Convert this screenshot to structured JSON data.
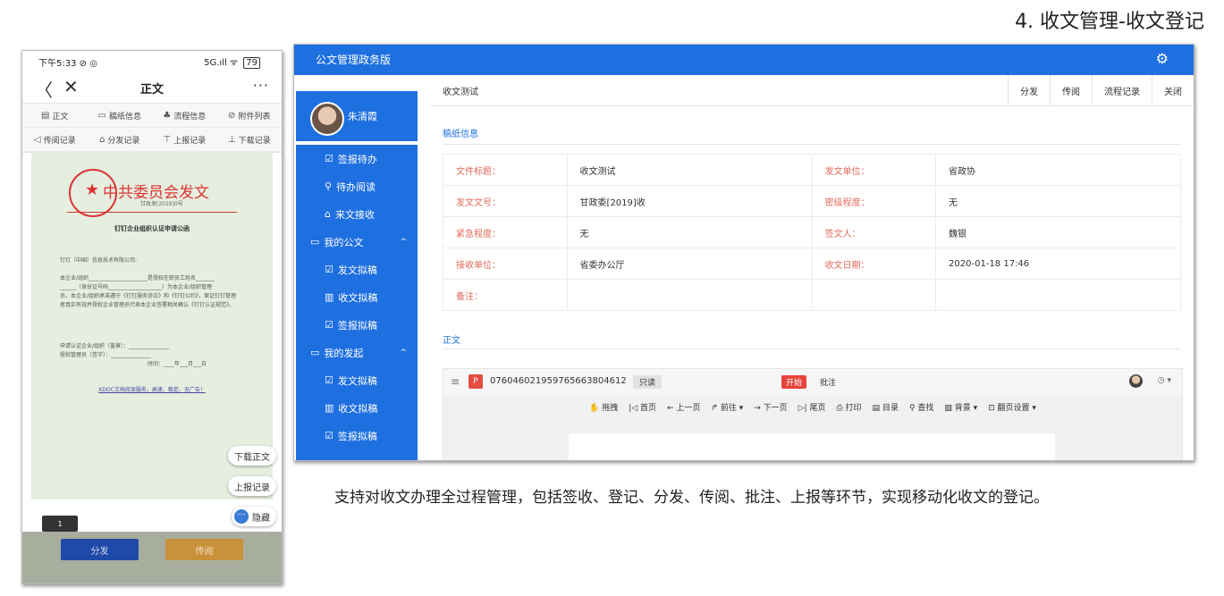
{
  "page": {
    "title": "4. 收文管理-收文登记"
  },
  "mobile": {
    "status": {
      "time": "下午5:33 ⊘ ◎",
      "signal": "5G.ıll ᯤ",
      "battery": "79"
    },
    "nav": {
      "back": "〈",
      "close": "✕",
      "title": "正文",
      "more": "···"
    },
    "tabs": [
      {
        "icon": "▤",
        "label": "正文"
      },
      {
        "icon": "▭",
        "label": "稿纸信息"
      },
      {
        "icon": "♣",
        "label": "流程信息"
      },
      {
        "icon": "⊘",
        "label": "附件列表"
      },
      {
        "icon": "◁",
        "label": "传阅记录"
      },
      {
        "icon": "⌂",
        "label": "分发记录"
      },
      {
        "icon": "⊤",
        "label": "上报记录"
      },
      {
        "icon": "⊥",
        "label": "下载记录"
      }
    ],
    "doc": {
      "header": "中共委员会发文",
      "number": "甘政发[2019]0号",
      "subject": "钉钉企业组织认证申请公函",
      "lines": [
        "钉钉（中国）信息技术有限公司:",
        "本企业/组织______________________是授权在职员工姓名_______",
        "______（身份证号码____________________）为本企业/组织管理",
        "员。本企业/组织承诺遵守《钉钉服务协议》和《钉钉公约》，保证钉钉管理",
        "者真实有效并授权企业管理员代表本企业签署相关确认《钉钉认证规范》。",
        "申请认证企业/组织（盖章）：_______________",
        "授权管理员（签字）：_______________",
        "时间：____年___月___日"
      ],
      "link": "XDOC文档阅读服务，高速、稳定、无广告！"
    },
    "floats": {
      "download": "下载正文",
      "report": "上报记录",
      "hide_icon": "···",
      "hide": "隐藏"
    },
    "page_no": "1",
    "bottom": {
      "distribute": "分发",
      "circulate": "传阅"
    }
  },
  "desktop": {
    "app_title": "公文管理政务版",
    "gear_icon": "⚙",
    "user": {
      "name": "朱清霞"
    },
    "menu": [
      {
        "type": "item",
        "icon": "☑",
        "label": "签报待办"
      },
      {
        "type": "item",
        "icon": "⚲",
        "label": "待办阅读"
      },
      {
        "type": "item",
        "icon": "⌂",
        "label": "来文接收"
      },
      {
        "type": "group",
        "icon": "▭",
        "label": "我的公文",
        "chev": "^"
      },
      {
        "type": "item",
        "icon": "☑",
        "label": "发文拟稿"
      },
      {
        "type": "item",
        "icon": "▥",
        "label": "收文拟稿"
      },
      {
        "type": "item",
        "icon": "☑",
        "label": "签报拟稿"
      },
      {
        "type": "group",
        "icon": "▭",
        "label": "我的发起",
        "chev": "^"
      },
      {
        "type": "item",
        "icon": "☑",
        "label": "发文拟稿"
      },
      {
        "type": "item",
        "icon": "▥",
        "label": "收文拟稿"
      },
      {
        "type": "item",
        "icon": "☑",
        "label": "签报拟稿"
      }
    ],
    "doc_title": "收文测试",
    "head_buttons": [
      "分发",
      "传阅",
      "流程记录",
      "关闭"
    ],
    "section_draft": "稿纸信息",
    "fields": [
      [
        {
          "k": "文件标题：",
          "v": "收文测试"
        },
        {
          "k": "发文单位：",
          "v": "省政协"
        }
      ],
      [
        {
          "k": "发文文号：",
          "v": "甘政委[2019]收"
        },
        {
          "k": "密级程度：",
          "v": "无"
        }
      ],
      [
        {
          "k": "紧急程度：",
          "v": "无"
        },
        {
          "k": "签文人：",
          "v": "魏银"
        }
      ],
      [
        {
          "k": "接收单位：",
          "v": "省委办公厅"
        },
        {
          "k": "收文日期：",
          "v": "2020-01-18 17:46"
        }
      ],
      [
        {
          "k": "备注：",
          "v": ""
        },
        {
          "k": "",
          "v": ""
        }
      ]
    ],
    "section_body": "正文",
    "viewer": {
      "menu_icon": "≡",
      "pdf_icon": "P",
      "file_id": "07604602195976566380461​2",
      "readonly": "只读",
      "start": "开始",
      "annotate": "批注",
      "clock": "◷ ▾",
      "tools": [
        "✋ 拖拽",
        "|◁ 首页",
        "← 上一页",
        "↱ 前往 ▾",
        "→ 下一页",
        "▷| 尾页",
        "⎙ 打印",
        "▤ 目录",
        "⚲ 查找",
        "▨ 背景 ▾",
        "⊡ 翻页设置 ▾"
      ]
    }
  },
  "caption": "支持对收文办理全过程管理，包括签收、登记、分发、传阅、批注、上报等环节，实现移动化收文的登记。"
}
